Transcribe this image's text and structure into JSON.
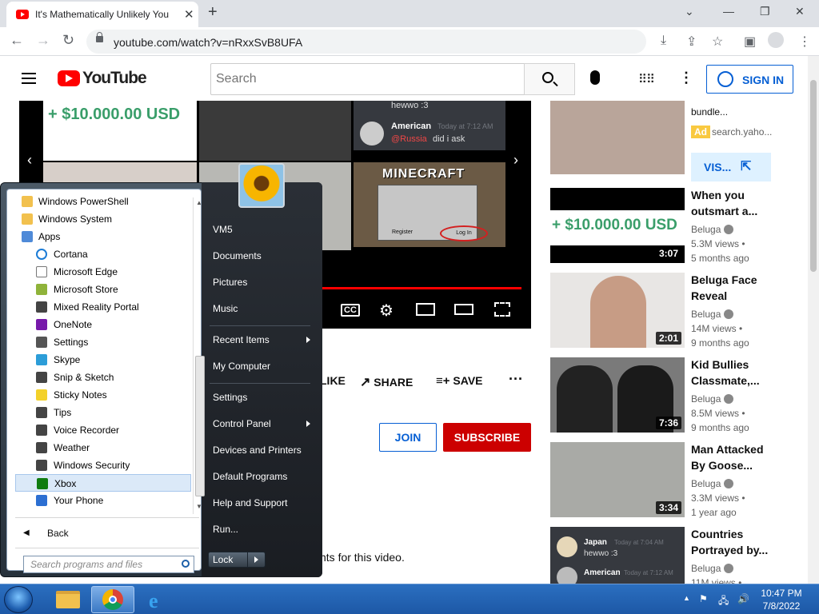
{
  "browser": {
    "tab_title": "It's Mathematically Unlikely You",
    "url": "youtube.com/watch?v=nRxxSvB8UFA"
  },
  "youtube": {
    "logo_text": "YouTube",
    "search_placeholder": "Search",
    "sign_in": "SIGN IN",
    "video": {
      "money_text": "+ $10.000.00 USD",
      "chat": [
        {
          "user": "",
          "msg": "hewwo :3"
        },
        {
          "user": "American",
          "time": "Today at 7:12 AM",
          "mention": "@Russia",
          "msg": "did i ask"
        }
      ],
      "minecraft_title": "MINECRAFT",
      "login_label": "Log In",
      "register_label": "Register"
    },
    "actions": {
      "like": "LIKE",
      "share": "SHARE",
      "save": "SAVE"
    },
    "join": "JOIN",
    "subscribe": "SUBSCRIBE",
    "comments_text": "nts for this video.",
    "sidebar": {
      "ad": {
        "text": "bundle...",
        "badge": "Ad",
        "domain": "search.yaho...",
        "visit": "VIS..."
      },
      "items": [
        {
          "title1": "When you",
          "title2": "outsmart a...",
          "channel": "Beluga",
          "views": "5.3M views •",
          "age": "5 months ago",
          "duration": "3:07",
          "thumb_text": "+ $10.000.00 USD"
        },
        {
          "title1": "Beluga Face",
          "title2": "Reveal",
          "channel": "Beluga",
          "views": "14M views •",
          "age": "9 months ago",
          "duration": "2:01"
        },
        {
          "title1": "Kid Bullies",
          "title2": "Classmate,...",
          "channel": "Beluga",
          "views": "8.5M views •",
          "age": "9 months ago",
          "duration": "7:36"
        },
        {
          "title1": "Man Attacked",
          "title2": "By Goose...",
          "channel": "Beluga",
          "views": "3.3M views •",
          "age": "1 year ago",
          "duration": "3:34"
        },
        {
          "title1": "Countries",
          "title2": "Portrayed by...",
          "channel": "Beluga",
          "views": "11M views •",
          "chat_user1": "Japan",
          "chat_time1": "Today at 7:04 AM",
          "chat_msg1": "hewwo :3",
          "chat_user2": "American",
          "chat_time2": "Today at 7:12 AM"
        }
      ]
    }
  },
  "start_menu": {
    "programs": [
      {
        "label": "Windows PowerShell",
        "icon": "folder-icon",
        "level": 0
      },
      {
        "label": "Windows System",
        "icon": "folder-icon",
        "level": 0
      },
      {
        "label": "Apps",
        "icon": "apps-folder-icon",
        "level": 0
      },
      {
        "label": "Cortana",
        "icon": "cortana-icon",
        "level": 1
      },
      {
        "label": "Microsoft Edge",
        "icon": "edge-icon",
        "level": 1
      },
      {
        "label": "Microsoft Store",
        "icon": "store-icon",
        "level": 1
      },
      {
        "label": "Mixed Reality Portal",
        "icon": "mixed-reality-icon",
        "level": 1
      },
      {
        "label": "OneNote",
        "icon": "onenote-icon",
        "level": 1
      },
      {
        "label": "Settings",
        "icon": "settings-icon",
        "level": 1
      },
      {
        "label": "Skype",
        "icon": "skype-icon",
        "level": 1
      },
      {
        "label": "Snip & Sketch",
        "icon": "snip-icon",
        "level": 1
      },
      {
        "label": "Sticky Notes",
        "icon": "sticky-notes-icon",
        "level": 1
      },
      {
        "label": "Tips",
        "icon": "tips-icon",
        "level": 1
      },
      {
        "label": "Voice Recorder",
        "icon": "voice-recorder-icon",
        "level": 1
      },
      {
        "label": "Weather",
        "icon": "weather-icon",
        "level": 1
      },
      {
        "label": "Windows Security",
        "icon": "security-icon",
        "level": 1
      },
      {
        "label": "Xbox",
        "icon": "xbox-icon",
        "level": 1,
        "selected": true
      },
      {
        "label": "Your Phone",
        "icon": "phone-icon",
        "level": 1
      }
    ],
    "back": "Back",
    "search_placeholder": "Search programs and files",
    "right_items": [
      {
        "label": "VM5",
        "arrow": false
      },
      {
        "label": "Documents",
        "arrow": false
      },
      {
        "label": "Pictures",
        "arrow": false
      },
      {
        "label": "Music",
        "arrow": false
      },
      {
        "label": "Recent Items",
        "arrow": true
      },
      {
        "label": "My Computer",
        "arrow": false
      },
      {
        "label": "Settings",
        "arrow": false
      },
      {
        "label": "Control Panel",
        "arrow": true
      },
      {
        "label": "Devices and Printers",
        "arrow": false
      },
      {
        "label": "Default Programs",
        "arrow": false
      },
      {
        "label": "Help and Support",
        "arrow": false
      },
      {
        "label": "Run...",
        "arrow": false
      }
    ],
    "lock": "Lock"
  },
  "taskbar": {
    "time": "10:47 PM",
    "date": "7/8/2022"
  },
  "colors": {
    "yt_red": "#ff0000",
    "yt_blue": "#065fd4",
    "subscribe_red": "#cc0000",
    "taskbar_blue": "#1d58a6"
  }
}
